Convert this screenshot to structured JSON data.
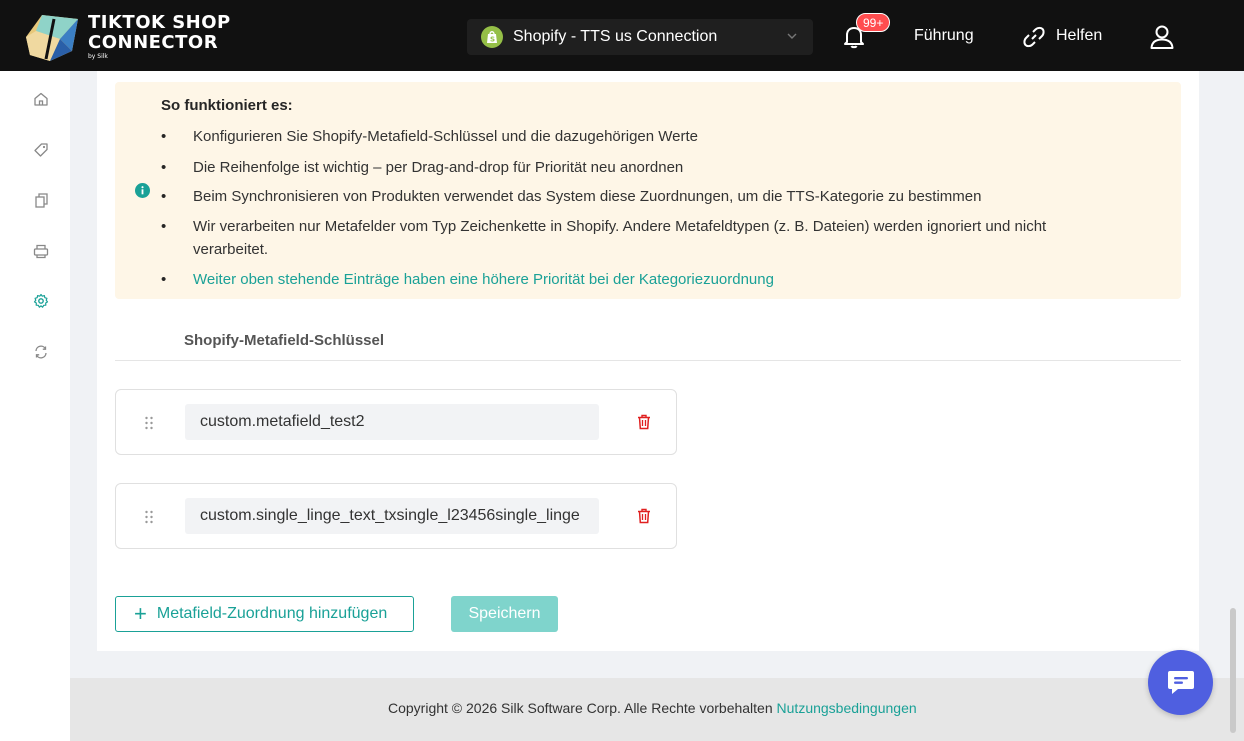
{
  "header": {
    "logo_line1": "TIKTOK SHOP",
    "logo_line2": "CONNECTOR",
    "logo_line3": "by Silk",
    "store_select": "Shopify - TTS us Connection",
    "notification_badge": "99+",
    "guide_label": "Führung",
    "help_label": "Helfen"
  },
  "sidebar": {
    "items": [
      "home-icon",
      "tag-icon",
      "copy-icon",
      "printer-icon",
      "settings-icon",
      "sync-icon"
    ],
    "active": "settings-icon"
  },
  "info": {
    "title": "So funktioniert es:",
    "bullets": [
      "Konfigurieren Sie Shopify-Metafield-Schlüssel und die dazugehörigen Werte",
      "Die Reihenfolge ist wichtig – per Drag-and-drop für Priorität neu anordnen",
      "Beim Synchronisieren von Produkten verwendet das System diese Zuordnungen, um die TTS-Kategorie zu bestimmen",
      "Wir verarbeiten nur Metafelder vom Typ Zeichenkette in Shopify. Andere Metafeldtypen (z. B. Dateien) werden ignoriert und nicht",
      "verarbeitet.",
      "Weiter oben stehende Einträge haben eine höhere Priorität bei der Kategoriezuordnung"
    ],
    "bullet_symbol": "•"
  },
  "table": {
    "column_header": "Shopify-Metafield-Schlüssel",
    "rows": [
      {
        "key": "custom.metafield_test2"
      },
      {
        "key": "custom.single_linge_text_txsingle_l23456single_linge"
      }
    ]
  },
  "actions": {
    "add_label": "Metafield-Zuordnung hinzufügen",
    "add_symbol": "+",
    "save_label": "Speichern"
  },
  "footer": {
    "text": "Copyright © 2026 Silk Software Corp. Alle Rechte vorbehalten",
    "link": "Nutzungsbedingungen"
  },
  "colors": {
    "accent": "#1aa197",
    "header_bg": "#111111",
    "info_bg": "#fef6e7",
    "danger": "#e02020",
    "chat": "#4f5fe0",
    "shopify": "#95bf47"
  }
}
